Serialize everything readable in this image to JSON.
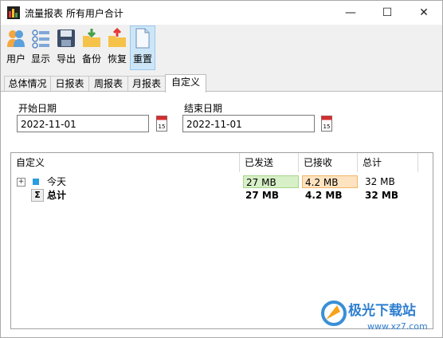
{
  "window": {
    "title": "流量报表 所有用户合计",
    "minimize": "—",
    "maximize": "☐",
    "close": "✕"
  },
  "toolbar": {
    "items": [
      {
        "label": "用户",
        "icon": "users-icon"
      },
      {
        "label": "显示",
        "icon": "list-icon"
      },
      {
        "label": "导出",
        "icon": "save-icon"
      },
      {
        "label": "备份",
        "icon": "backup-icon"
      },
      {
        "label": "恢复",
        "icon": "restore-icon"
      },
      {
        "label": "重置",
        "icon": "document-icon",
        "active": true
      }
    ]
  },
  "tabs": [
    {
      "label": "总体情况"
    },
    {
      "label": "日报表"
    },
    {
      "label": "周报表"
    },
    {
      "label": "月报表"
    },
    {
      "label": "自定义",
      "active": true
    }
  ],
  "filters": {
    "start_label": "开始日期",
    "start_value": "2022-11-01",
    "end_label": "结束日期",
    "end_value": "2022-11-01",
    "calendar_day": "15"
  },
  "table": {
    "columns": [
      "自定义",
      "已发送",
      "已接收",
      "总计"
    ],
    "rows": [
      {
        "name": "今天",
        "sent": "27 MB",
        "received": "4.2 MB",
        "total": "32 MB"
      },
      {
        "name": "总计",
        "sent": "27 MB",
        "received": "4.2 MB",
        "total": "32 MB",
        "sigma": "Σ"
      }
    ]
  },
  "watermark": {
    "brand": "极光下载站",
    "url": "www.xz7.com"
  },
  "colors": {
    "sent_bg": "#d8f0c8",
    "received_bg": "#fde3c0",
    "accent": "#2a9de0"
  }
}
